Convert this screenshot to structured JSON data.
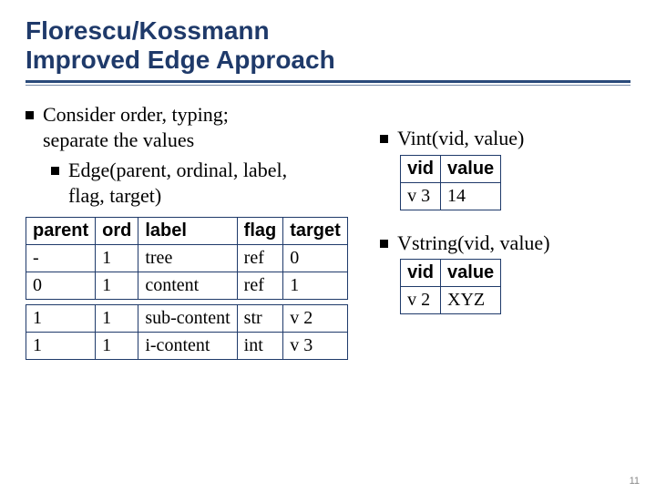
{
  "title_line1": "Florescu/Kossmann",
  "title_line2": "Improved Edge Approach",
  "left": {
    "b1a": "Consider order, typing;",
    "b1b": "separate the values",
    "b2a": "Edge(parent, ordinal, label,",
    "b2b": "flag, target)"
  },
  "edge_table": {
    "headers": {
      "c0": "parent",
      "c1": "ord",
      "c2": "label",
      "c3": "flag",
      "c4": "target"
    },
    "rows": [
      {
        "c0": "-",
        "c1": "1",
        "c2": "tree",
        "c3": "ref",
        "c4": "0"
      },
      {
        "c0": "0",
        "c1": "1",
        "c2": "content",
        "c3": "ref",
        "c4": "1"
      },
      {
        "c0": "1",
        "c1": "1",
        "c2": "sub-content",
        "c3": "str",
        "c4": "v 2"
      },
      {
        "c0": "1",
        "c1": "1",
        "c2": "i-content",
        "c3": "int",
        "c4": "v 3"
      }
    ]
  },
  "right": {
    "vint_label": "Vint(vid, value)",
    "vstring_label": "Vstring(vid, value)"
  },
  "vint_table": {
    "headers": {
      "c0": "vid",
      "c1": "value"
    },
    "rows": [
      {
        "c0": "v 3",
        "c1": "14"
      }
    ]
  },
  "vstring_table": {
    "headers": {
      "c0": "vid",
      "c1": "value"
    },
    "rows": [
      {
        "c0": "v 2",
        "c1": "XYZ"
      }
    ]
  },
  "page_number": "11"
}
